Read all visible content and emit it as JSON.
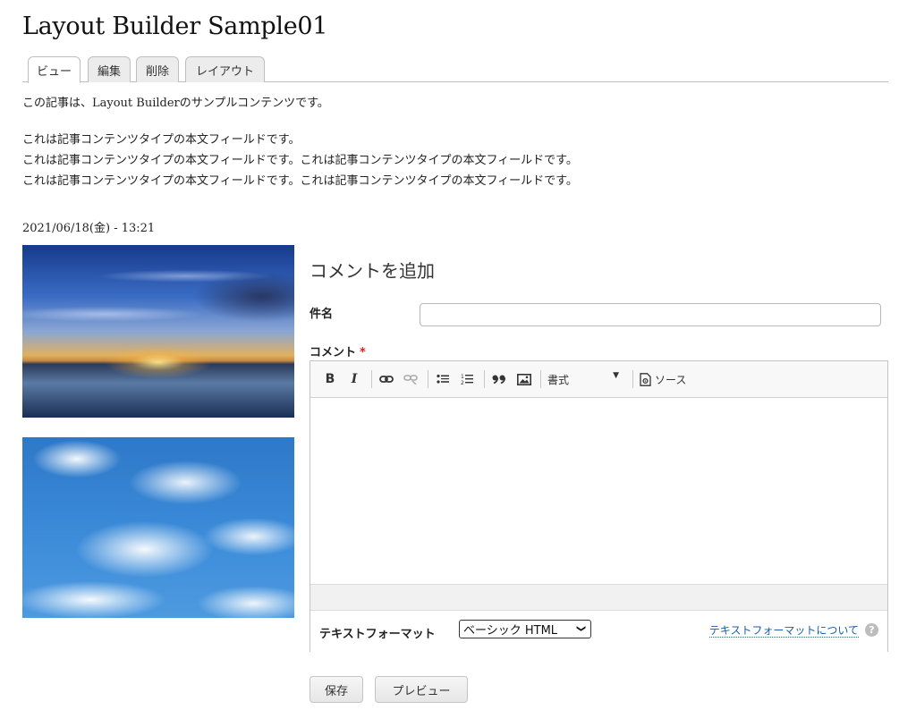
{
  "page": {
    "title": "Layout Builder Sample01"
  },
  "tabs": [
    {
      "label": "ビュー",
      "active": true
    },
    {
      "label": "編集"
    },
    {
      "label": "削除"
    },
    {
      "label": "レイアウト"
    }
  ],
  "content": {
    "intro": "この記事は、Layout Builderのサンプルコンテンツです。",
    "body_lines": [
      "これは記事コンテンツタイプの本文フィールドです。",
      "これは記事コンテンツタイプの本文フィールドです。これは記事コンテンツタイプの本文フィールドです。",
      "これは記事コンテンツタイプの本文フィールドです。これは記事コンテンツタイプの本文フィールドです。"
    ],
    "date": "2021/06/18(金) - 13:21"
  },
  "images": [
    {
      "name": "sunset-over-water"
    },
    {
      "name": "blue-sky-clouds"
    }
  ],
  "comment_form": {
    "heading": "コメントを追加",
    "subject_label": "件名",
    "subject_value": "",
    "comment_label": "コメント",
    "required_mark": "*",
    "toolbar": {
      "bold": "B",
      "italic": "I",
      "format_combo": "書式",
      "source": "ソース",
      "icons": [
        "bold-icon",
        "italic-icon",
        "link-icon",
        "unlink-icon",
        "bulleted-list-icon",
        "numbered-list-icon",
        "blockquote-icon",
        "image-icon",
        "format-dropdown-icon",
        "source-icon"
      ]
    },
    "text_format_label": "テキストフォーマット",
    "text_format_selected": "ベーシック HTML",
    "text_format_help": "テキストフォーマットについて",
    "help_icon_glyph": "?",
    "save_label": "保存",
    "preview_label": "プレビュー"
  },
  "colors": {
    "link": "#1a5ea8",
    "required": "#e02020",
    "border": "#c4c4c4"
  }
}
